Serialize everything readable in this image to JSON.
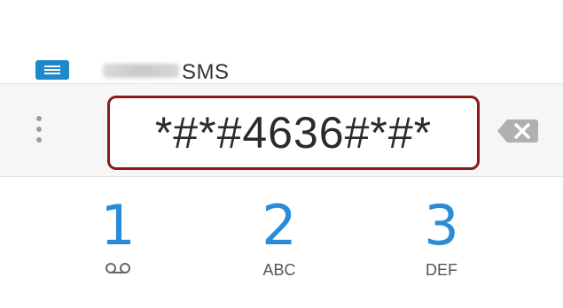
{
  "header": {
    "sms_label": "SMS",
    "icons": {
      "message": "message-icon"
    }
  },
  "dialer": {
    "input_value": "*#*#4636#*#*",
    "icons": {
      "menu": "overflow-menu-icon",
      "backspace": "backspace-icon"
    }
  },
  "keypad": {
    "keys": [
      {
        "digit": "1",
        "sub": "",
        "icon": "voicemail-icon"
      },
      {
        "digit": "2",
        "sub": "ABC"
      },
      {
        "digit": "3",
        "sub": "DEF"
      }
    ]
  },
  "colors": {
    "accent": "#2a8bd6",
    "highlight_border": "#8b1a1a",
    "message_icon": "#1e88c8"
  }
}
